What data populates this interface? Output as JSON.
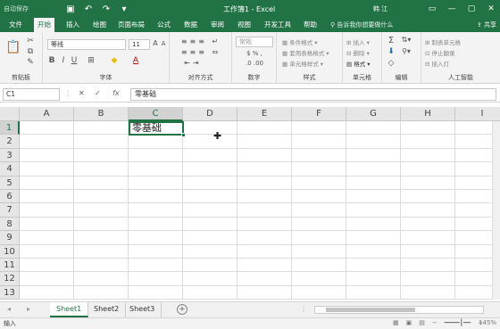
{
  "titlebar": {
    "autosave": "自动保存",
    "title": "工作簿1  -  Excel",
    "user": "韩 江",
    "colors": {
      "brand": "#217346"
    }
  },
  "tabs": [
    "文件",
    "开始",
    "插入",
    "绘图",
    "页面布局",
    "公式",
    "数据",
    "审阅",
    "视图",
    "开发工具",
    "帮助"
  ],
  "active_tab": "开始",
  "tellme": "告诉我你想要做什么",
  "share": "共享",
  "ribbon": {
    "groups": {
      "clipboard": "剪贴板",
      "font": "字体",
      "alignment": "对齐方式",
      "number": "数字",
      "styles": "样式",
      "cells": "单元格",
      "editing": "编辑",
      "ai": "人工智能"
    },
    "font_name": "等线",
    "font_size": "11",
    "number_format": "常规",
    "styles_items": [
      "条件格式",
      "套用表格格式",
      "单元格样式"
    ],
    "cells_items": [
      "插入",
      "删除",
      "格式"
    ],
    "ai_items": [
      "制表单元格",
      "停止翻录",
      "插入灯"
    ]
  },
  "formula_bar": {
    "namebox": "C1",
    "fx": "fx",
    "formula": "零基础"
  },
  "grid": {
    "columns": [
      "A",
      "B",
      "C",
      "D",
      "E",
      "F",
      "G",
      "H",
      "I"
    ],
    "selected_column": "C",
    "rows": [
      "1",
      "2",
      "3",
      "4",
      "5",
      "6",
      "7",
      "8",
      "9",
      "10",
      "11",
      "12",
      "13"
    ],
    "selected_row": "1",
    "active_cell_value": "零基础"
  },
  "sheets": [
    "Sheet1",
    "Sheet2",
    "Sheet3"
  ],
  "active_sheet": "Sheet1",
  "status": {
    "mode": "输入",
    "zoom": "145%"
  }
}
